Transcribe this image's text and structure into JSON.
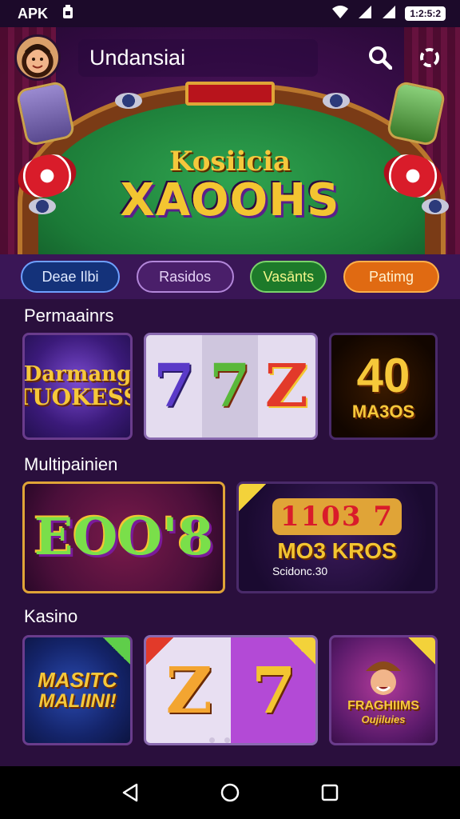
{
  "status_bar": {
    "left_label": "APK",
    "battery": "1:2:5:2"
  },
  "header": {
    "app_name": "Undansiai"
  },
  "hero": {
    "subtitle": "Kosiicia",
    "title": "XAOOHS"
  },
  "pills": [
    {
      "label": "Deae Ilbi"
    },
    {
      "label": "Rasidos"
    },
    {
      "label": "Vasānts"
    },
    {
      "label": "Patimg"
    }
  ],
  "sections": [
    {
      "title": "Permaainrs",
      "tiles": [
        {
          "line1": "Darmang",
          "line2": "TUOKESS"
        },
        {
          "reels": [
            "7",
            "7",
            "Z"
          ]
        },
        {
          "line1": "40",
          "line2": "MA3OS"
        }
      ]
    },
    {
      "title": "Multipainien",
      "tiles": [
        {
          "line1": "EOO'8"
        },
        {
          "line1": "1103 7",
          "line2": "MO3 KROS",
          "caption": "Scidonc.30"
        }
      ]
    },
    {
      "title": "Kasino",
      "tiles": [
        {
          "line1": "MASITC",
          "line2": "MALIINI!"
        },
        {
          "reels": [
            "Z",
            "7"
          ]
        },
        {
          "line1": "FRAGHIIMS",
          "line2": "Oujiluies"
        }
      ]
    }
  ],
  "colors": {
    "background": "#2a0f3d",
    "gold": "#f6c83a",
    "felt": "#1b7a37"
  }
}
